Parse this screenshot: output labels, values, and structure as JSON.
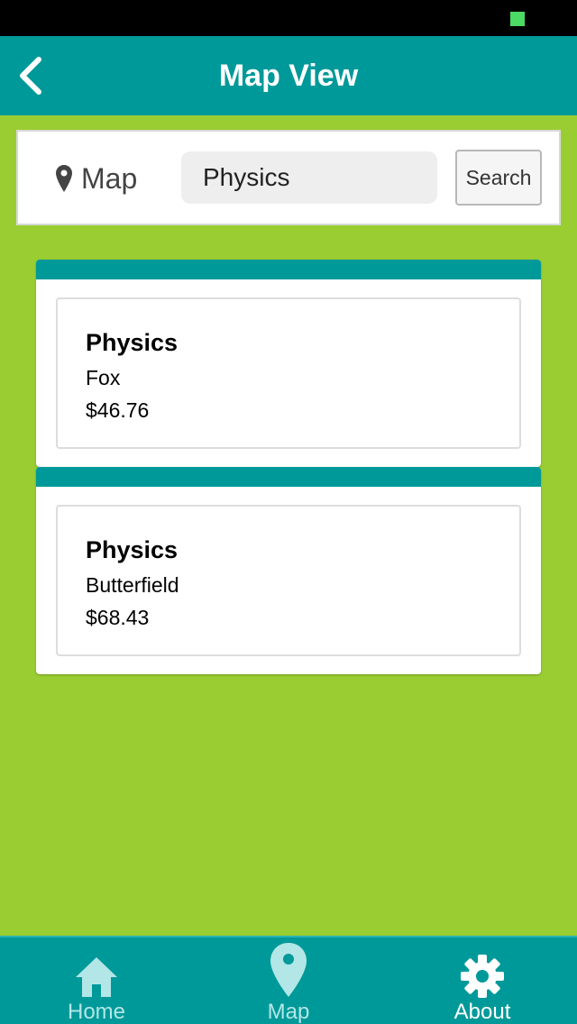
{
  "header": {
    "title": "Map View",
    "back_icon": "chevron-left-icon"
  },
  "search": {
    "location_label": "Map",
    "location_icon": "map-pin-icon",
    "query": "Physics",
    "button_label": "Search"
  },
  "results": [
    {
      "title": "Physics",
      "building": "Fox",
      "price": "$46.76"
    },
    {
      "title": "Physics",
      "building": "Butterfield",
      "price": "$68.43"
    }
  ],
  "tabs": [
    {
      "label": "Home",
      "icon": "home-icon",
      "active": false
    },
    {
      "label": "Map",
      "icon": "map-pin-icon",
      "active": false
    },
    {
      "label": "About",
      "icon": "gear-icon",
      "active": true
    }
  ],
  "colors": {
    "background": "#9acd32",
    "accent": "#009999",
    "tab_inactive": "#b3e6e6",
    "tab_active": "#ffffff"
  }
}
